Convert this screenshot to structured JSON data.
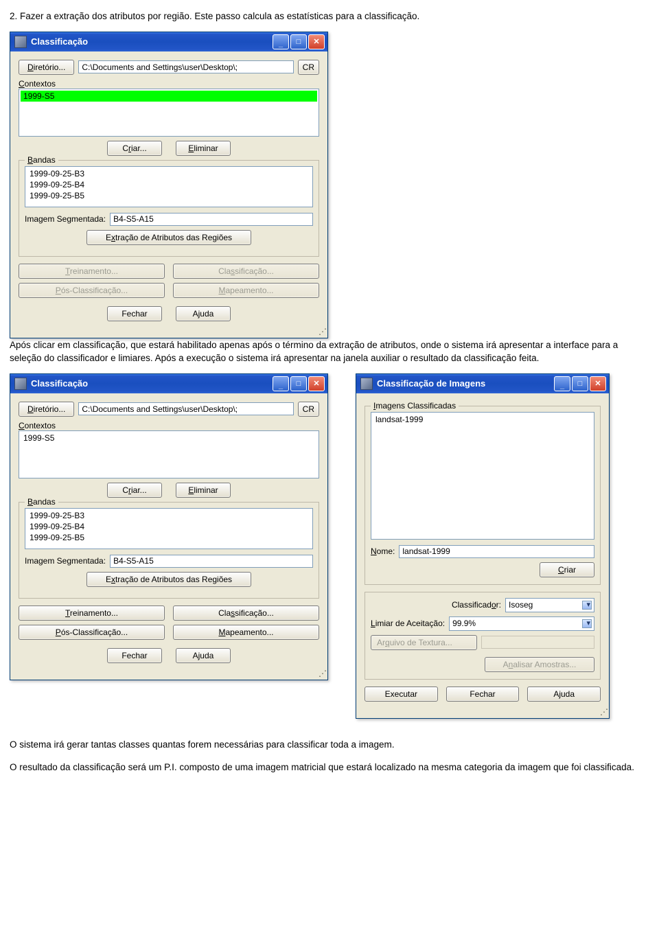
{
  "text": {
    "instr_top": "2. Fazer a extração dos atributos por região. Este passo calcula as estatísticas para a classificação.",
    "instr_mid": "Após clicar em classificação, que estará habilitado apenas após o término da extração de atributos, onde o sistema irá apresentar a interface para a seleção do classificador e limiares. Após a execução o sistema irá apresentar na janela auxiliar o resultado da classificação feita.",
    "instr_bottom1": "O sistema irá gerar tantas classes quantas forem necessárias para classificar toda a imagem.",
    "instr_bottom2": "O resultado da classificação será um P.I. composto de uma imagem matricial que estará localizado na mesma categoria da imagem que foi classificada."
  },
  "winA": {
    "title": "Classificação",
    "directory_btn": "Diretório...",
    "directory_btn_u": "D",
    "directory_value": "C:\\Documents and Settings\\user\\Desktop\\;",
    "cr_btn": "CR",
    "contextos_label": "Contextos",
    "contextos_u": "C",
    "context_item": "1999-S5",
    "criar_btn": "Criar...",
    "criar_u": "r",
    "eliminar_btn": "Eliminar",
    "eliminar_u": "E",
    "bandas_label": "Bandas",
    "bandas_u": "B",
    "bandas": [
      "1999-09-25-B3",
      "1999-09-25-B4",
      "1999-09-25-B5"
    ],
    "imgseg_label": "Imagem Segmentada:",
    "imgseg_value": "B4-S5-A15",
    "extracao_btn": "Extração de Atributos das Regiões",
    "extracao_u": "x",
    "treinamento_btn": "Treinamento...",
    "treinamento_u": "T",
    "classificacao_btn": "Classificação...",
    "classificacao_u": "s",
    "posclass_btn": "Pós-Classificação...",
    "posclass_u": "P",
    "mapeamento_btn": "Mapeamento...",
    "mapeamento_u": "M",
    "fechar_btn": "Fechar",
    "ajuda_btn": "Ajuda"
  },
  "winC": {
    "title": "Classificação de Imagens",
    "imagens_label": "Imagens Classificadas",
    "imagens_u": "I",
    "imagens_item": "landsat-1999",
    "nome_label": "Nome:",
    "nome_u": "N",
    "nome_value": "landsat-1999",
    "criar_btn": "Criar",
    "criar_u": "C",
    "classificador_label": "Classificador:",
    "classificador_u": "o",
    "classificador_value": "Isoseg",
    "limiar_label": "Limiar de Aceitação:",
    "limiar_u": "L",
    "limiar_value": "99.9%",
    "arquivo_btn": "Arquivo de Textura...",
    "arquivo_u": "q",
    "analisar_btn": "Analisar Amostras...",
    "analisar_u": "n",
    "executar_btn": "Executar",
    "fechar_btn": "Fechar",
    "ajuda_btn": "Ajuda"
  }
}
